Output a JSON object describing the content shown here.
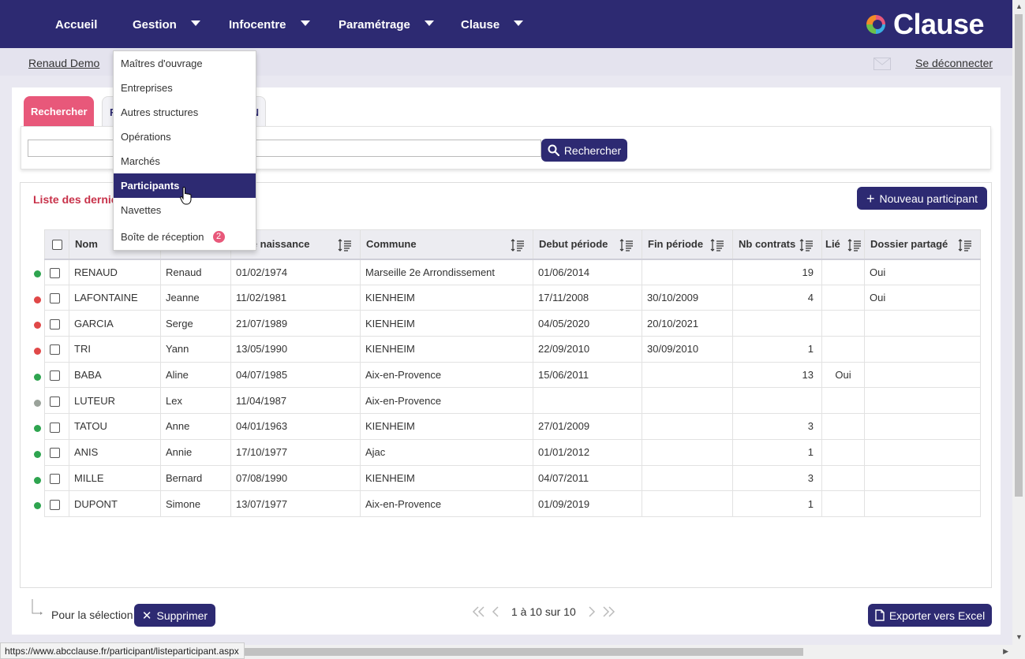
{
  "nav": {
    "items": [
      {
        "label": "Accueil"
      },
      {
        "label": "Gestion"
      },
      {
        "label": "Infocentre"
      },
      {
        "label": "Paramétrage"
      },
      {
        "label": "Clause"
      }
    ],
    "logo_text": "Clause"
  },
  "subbar": {
    "user": "Renaud Demo",
    "logout": "Se déconnecter"
  },
  "tabs": {
    "search": "Rechercher",
    "second_visible_prefix": "F",
    "second_visible_suffix": "N"
  },
  "search": {
    "value": "",
    "button": "Rechercher"
  },
  "list": {
    "title_visible": "Liste des dernier",
    "new_button": "Nouveau participant"
  },
  "table": {
    "headers": [
      "Nom",
      "",
      "e de naissance",
      "Commune",
      "Debut période",
      "Fin période",
      "Nb contrats",
      "Lié",
      "Dossier partagé"
    ],
    "rows": [
      {
        "status": "green",
        "nom": "RENAUD",
        "prenom": "Renaud",
        "naissance": "01/02/1974",
        "commune": "Marseille 2e Arrondissement",
        "debut": "01/06/2014",
        "fin": "",
        "nb": "19",
        "lie": "",
        "dossier": "Oui"
      },
      {
        "status": "red",
        "nom": "LAFONTAINE",
        "prenom": "Jeanne",
        "naissance": "11/02/1981",
        "commune": "KIENHEIM",
        "debut": "17/11/2008",
        "fin": "30/10/2009",
        "nb": "4",
        "lie": "",
        "dossier": "Oui"
      },
      {
        "status": "red",
        "nom": "GARCIA",
        "prenom": "Serge",
        "naissance": "21/07/1989",
        "commune": "KIENHEIM",
        "debut": "04/05/2020",
        "fin": "20/10/2021",
        "nb": "",
        "lie": "",
        "dossier": ""
      },
      {
        "status": "red",
        "nom": "TRI",
        "prenom": "Yann",
        "naissance": "13/05/1990",
        "commune": "KIENHEIM",
        "debut": "22/09/2010",
        "fin": "30/09/2010",
        "nb": "1",
        "lie": "",
        "dossier": ""
      },
      {
        "status": "green",
        "nom": "BABA",
        "prenom": "Aline",
        "naissance": "04/07/1985",
        "commune": "Aix-en-Provence",
        "debut": "15/06/2011",
        "fin": "",
        "nb": "13",
        "lie": "Oui",
        "dossier": ""
      },
      {
        "status": "gray",
        "nom": "LUTEUR",
        "prenom": "Lex",
        "naissance": "11/04/1987",
        "commune": "Aix-en-Provence",
        "debut": "",
        "fin": "",
        "nb": "",
        "lie": "",
        "dossier": ""
      },
      {
        "status": "green",
        "nom": "TATOU",
        "prenom": "Anne",
        "naissance": "04/01/1963",
        "commune": "KIENHEIM",
        "debut": "27/01/2009",
        "fin": "",
        "nb": "3",
        "lie": "",
        "dossier": ""
      },
      {
        "status": "green",
        "nom": "ANIS",
        "prenom": "Annie",
        "naissance": "17/10/1977",
        "commune": "Ajac",
        "debut": "01/01/2012",
        "fin": "",
        "nb": "1",
        "lie": "",
        "dossier": ""
      },
      {
        "status": "green",
        "nom": "MILLE",
        "prenom": "Bernard",
        "naissance": "07/08/1990",
        "commune": "KIENHEIM",
        "debut": "04/07/2011",
        "fin": "",
        "nb": "3",
        "lie": "",
        "dossier": ""
      },
      {
        "status": "green",
        "nom": "DUPONT",
        "prenom": "Simone",
        "naissance": "13/07/1977",
        "commune": "Aix-en-Provence",
        "debut": "01/09/2019",
        "fin": "",
        "nb": "1",
        "lie": "",
        "dossier": ""
      }
    ]
  },
  "footer": {
    "selection_label": "Pour la sélection",
    "delete_button": "Supprimer",
    "pager_text": "1 à 10 sur 10",
    "export_button": "Exporter vers Excel"
  },
  "dropdown": {
    "items": [
      {
        "label": "Maîtres d'ouvrage"
      },
      {
        "label": "Entreprises"
      },
      {
        "label": "Autres structures"
      },
      {
        "label": "Opérations"
      },
      {
        "label": "Marchés"
      },
      {
        "label": "Participants"
      },
      {
        "label": "Navettes"
      },
      {
        "label": "Boîte de réception"
      }
    ],
    "badge": "2"
  },
  "statusbar": "https://www.abcclause.fr/participant/listeparticipant.aspx",
  "colors": {
    "primary": "#2d2a72",
    "accent": "#e8587a",
    "title_red": "#c8324a",
    "status_green": "#2ea44f",
    "status_red": "#e04848",
    "status_gray": "#9aa29a"
  }
}
